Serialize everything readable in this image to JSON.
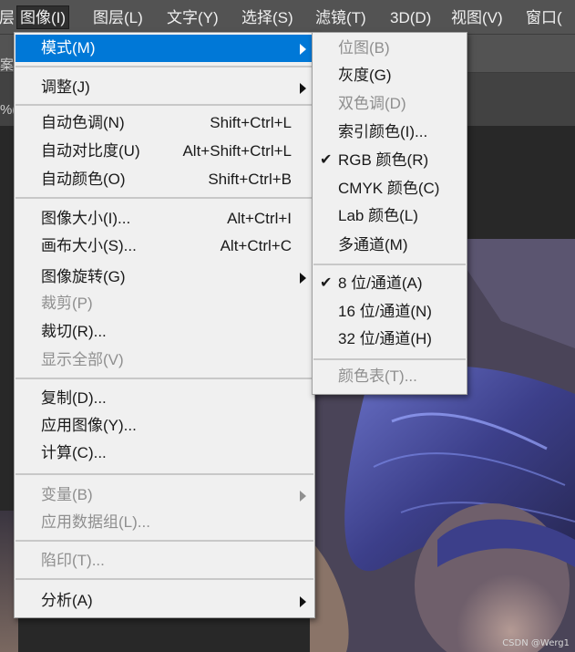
{
  "menubar": {
    "items": [
      {
        "label": "层",
        "active": false
      },
      {
        "label": "图像(I)",
        "active": true
      },
      {
        "label": "图层(L)",
        "active": false
      },
      {
        "label": "文字(Y)",
        "active": false
      },
      {
        "label": "选择(S)",
        "active": false
      },
      {
        "label": "滤镜(T)",
        "active": false
      },
      {
        "label": "3D(D)",
        "active": false
      },
      {
        "label": "视图(V)",
        "active": false
      },
      {
        "label": "窗口(",
        "active": false
      }
    ]
  },
  "background": {
    "optbar_stub": "案动",
    "tab_stub": "%("
  },
  "image_menu": {
    "items": [
      {
        "label": "模式(M)",
        "shortcut": "",
        "submenu": true,
        "disabled": false,
        "highlighted": true
      },
      {
        "label": "调整(J)",
        "shortcut": "",
        "submenu": true,
        "disabled": false
      },
      {
        "label": "自动色调(N)",
        "shortcut": "Shift+Ctrl+L",
        "submenu": false,
        "disabled": false
      },
      {
        "label": "自动对比度(U)",
        "shortcut": "Alt+Shift+Ctrl+L",
        "submenu": false,
        "disabled": false
      },
      {
        "label": "自动颜色(O)",
        "shortcut": "Shift+Ctrl+B",
        "submenu": false,
        "disabled": false
      },
      {
        "label": "图像大小(I)...",
        "shortcut": "Alt+Ctrl+I",
        "submenu": false,
        "disabled": false
      },
      {
        "label": "画布大小(S)...",
        "shortcut": "Alt+Ctrl+C",
        "submenu": false,
        "disabled": false
      },
      {
        "label": "图像旋转(G)",
        "shortcut": "",
        "submenu": true,
        "disabled": false
      },
      {
        "label": "裁剪(P)",
        "shortcut": "",
        "submenu": false,
        "disabled": true
      },
      {
        "label": "裁切(R)...",
        "shortcut": "",
        "submenu": false,
        "disabled": false
      },
      {
        "label": "显示全部(V)",
        "shortcut": "",
        "submenu": false,
        "disabled": true
      },
      {
        "label": "复制(D)...",
        "shortcut": "",
        "submenu": false,
        "disabled": false
      },
      {
        "label": "应用图像(Y)...",
        "shortcut": "",
        "submenu": false,
        "disabled": false
      },
      {
        "label": "计算(C)...",
        "shortcut": "",
        "submenu": false,
        "disabled": false
      },
      {
        "label": "变量(B)",
        "shortcut": "",
        "submenu": true,
        "disabled": true
      },
      {
        "label": "应用数据组(L)...",
        "shortcut": "",
        "submenu": false,
        "disabled": true
      },
      {
        "label": "陷印(T)...",
        "shortcut": "",
        "submenu": false,
        "disabled": true
      },
      {
        "label": "分析(A)",
        "shortcut": "",
        "submenu": true,
        "disabled": false
      }
    ]
  },
  "mode_submenu": {
    "items": [
      {
        "label": "位图(B)",
        "checked": false,
        "disabled": true
      },
      {
        "label": "灰度(G)",
        "checked": false,
        "disabled": false
      },
      {
        "label": "双色调(D)",
        "checked": false,
        "disabled": true
      },
      {
        "label": "索引颜色(I)...",
        "checked": false,
        "disabled": false
      },
      {
        "label": "RGB 颜色(R)",
        "checked": true,
        "disabled": false
      },
      {
        "label": "CMYK 颜色(C)",
        "checked": false,
        "disabled": false
      },
      {
        "label": "Lab 颜色(L)",
        "checked": false,
        "disabled": false
      },
      {
        "label": "多通道(M)",
        "checked": false,
        "disabled": false
      },
      {
        "label": "8 位/通道(A)",
        "checked": true,
        "disabled": false
      },
      {
        "label": "16 位/通道(N)",
        "checked": false,
        "disabled": false
      },
      {
        "label": "32 位/通道(H)",
        "checked": false,
        "disabled": false
      },
      {
        "label": "颜色表(T)...",
        "checked": false,
        "disabled": true
      }
    ],
    "check_glyph": "✔"
  },
  "watermark": "CSDN @Werg1",
  "colors": {
    "highlight": "#0078d7",
    "menu_bg": "#f0f0f0",
    "disabled_text": "#8f8f8f",
    "menubar_bg": "#535353"
  }
}
